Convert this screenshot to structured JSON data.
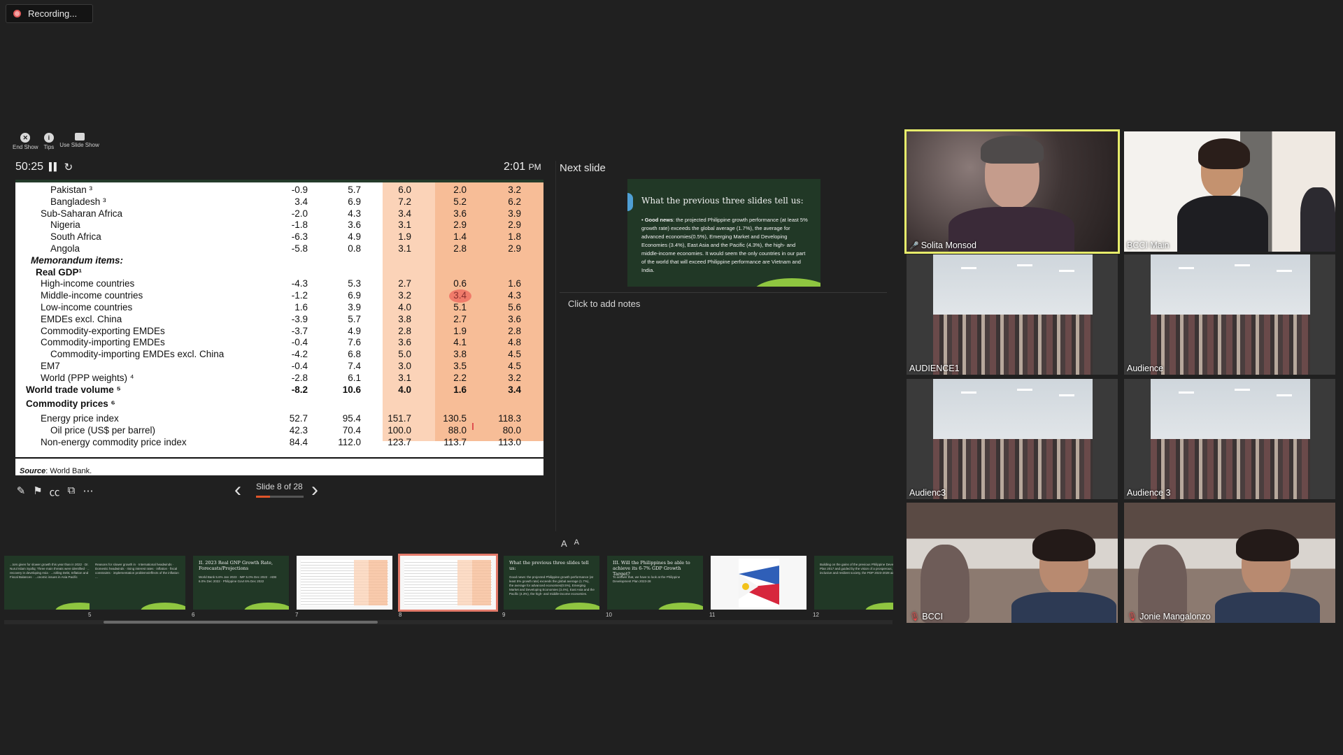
{
  "recording": {
    "label": "Recording..."
  },
  "toolbar": {
    "end_show": "End Show",
    "tips": "Tips",
    "use_slide_show": "Use Slide Show"
  },
  "presenter": {
    "elapsed": "50:25",
    "clock_time": "2:01",
    "clock_ampm": "PM",
    "slide_counter": "Slide 8 of 28",
    "progress_fraction": 0.29,
    "next_slide_label": "Next slide",
    "notes_placeholder": "Click to add notes",
    "font_larger": "A",
    "font_smaller": "A"
  },
  "current_slide": {
    "source_label": "Source",
    "source_text": ": World Bank.",
    "highlighted_value": "3.4",
    "rows": [
      {
        "label": "Pakistan ³",
        "indent": 3,
        "style": "normal",
        "values": [
          "-0.9",
          "5.7",
          "6.0",
          "2.0",
          "3.2"
        ]
      },
      {
        "label": "Bangladesh ³",
        "indent": 3,
        "style": "normal",
        "values": [
          "3.4",
          "6.9",
          "7.2",
          "5.2",
          "6.2"
        ]
      },
      {
        "label": "Sub-Saharan Africa",
        "indent": 2,
        "style": "normal",
        "values": [
          "-2.0",
          "4.3",
          "3.4",
          "3.6",
          "3.9"
        ]
      },
      {
        "label": "Nigeria",
        "indent": 3,
        "style": "normal",
        "values": [
          "-1.8",
          "3.6",
          "3.1",
          "2.9",
          "2.9"
        ]
      },
      {
        "label": "South Africa",
        "indent": 3,
        "style": "normal",
        "values": [
          "-6.3",
          "4.9",
          "1.9",
          "1.4",
          "1.8"
        ]
      },
      {
        "label": "Angola",
        "indent": 3,
        "style": "normal",
        "values": [
          "-5.8",
          "0.8",
          "3.1",
          "2.8",
          "2.9"
        ]
      },
      {
        "label": "Memorandum items:",
        "indent": 1,
        "style": "italic",
        "values": [
          "",
          "",
          "",
          "",
          ""
        ]
      },
      {
        "label": "Real GDP¹",
        "indent": 1.5,
        "style": "bold",
        "values": [
          "",
          "",
          "",
          "",
          ""
        ]
      },
      {
        "label": "High-income countries",
        "indent": 2,
        "style": "normal",
        "values": [
          "-4.3",
          "5.3",
          "2.7",
          "0.6",
          "1.6"
        ]
      },
      {
        "label": "Middle-income countries",
        "indent": 2,
        "style": "normal",
        "values": [
          "-1.2",
          "6.9",
          "3.2",
          "3.4",
          "4.3"
        ]
      },
      {
        "label": "Low-income countries",
        "indent": 2,
        "style": "normal",
        "values": [
          "1.6",
          "3.9",
          "4.0",
          "5.1",
          "5.6"
        ]
      },
      {
        "label": "EMDEs excl. China",
        "indent": 2,
        "style": "normal",
        "values": [
          "-3.9",
          "5.7",
          "3.8",
          "2.7",
          "3.6"
        ]
      },
      {
        "label": "Commodity-exporting EMDEs",
        "indent": 2,
        "style": "normal",
        "values": [
          "-3.7",
          "4.9",
          "2.8",
          "1.9",
          "2.8"
        ]
      },
      {
        "label": "Commodity-importing EMDEs",
        "indent": 2,
        "style": "normal",
        "values": [
          "-0.4",
          "7.6",
          "3.6",
          "4.1",
          "4.8"
        ]
      },
      {
        "label": "Commodity-importing EMDEs excl. China",
        "indent": 3,
        "style": "normal",
        "values": [
          "-4.2",
          "6.8",
          "5.0",
          "3.8",
          "4.5"
        ]
      },
      {
        "label": "EM7",
        "indent": 2,
        "style": "normal",
        "values": [
          "-0.4",
          "7.4",
          "3.0",
          "3.5",
          "4.5"
        ]
      },
      {
        "label": "World (PPP weights) ⁴",
        "indent": 2,
        "style": "normal",
        "values": [
          "-2.8",
          "6.1",
          "3.1",
          "2.2",
          "3.2"
        ]
      },
      {
        "label": "World trade volume ⁵",
        "indent": 0.5,
        "style": "bold",
        "values": [
          "-8.2",
          "10.6",
          "4.0",
          "1.6",
          "3.4"
        ]
      },
      {
        "label": "Commodity prices ⁶",
        "indent": 0.5,
        "style": "bold",
        "values": [
          "",
          "",
          "",
          "",
          ""
        ],
        "gap_before": 4
      },
      {
        "label": "Energy price index",
        "indent": 2,
        "style": "normal",
        "values": [
          "52.7",
          "95.4",
          "151.7",
          "130.5",
          "118.3"
        ],
        "gap_before": 4
      },
      {
        "label": "Oil price (US$ per barrel)",
        "indent": 3,
        "style": "normal",
        "values": [
          "42.3",
          "70.4",
          "100.0",
          "88.0",
          "80.0"
        ]
      },
      {
        "label": "Non-energy commodity price index",
        "indent": 2,
        "style": "normal",
        "values": [
          "84.4",
          "112.0",
          "123.7",
          "113.7",
          "113.0"
        ]
      }
    ]
  },
  "next_slide": {
    "title": "What the previous three slides tell us:",
    "bold_lead": "Good news",
    "body": ": the projected Philippine growth performance (at least 5% growth rate) exceeds the global average (1.7%), the average for advanced economies(0.5%), Emerging Market and Developing Economies (3.4%), East Asia and the Pacific (4.3%), the high- and middle-income economies. It would seem the only countries in our part of the world that will exceed Philippine performance are Vietnam and India."
  },
  "thumbnails": [
    {
      "num": "",
      "type": "text",
      "title": "",
      "body": "...tors given for slower growth this year than in 2022 · Dr. Nurul Islam Syafiq: Three main threats were identified · ...s recovery in developing Asia · ...rolling Debt, Inflation and Fiscal Balances · ...onomic issues in Asia Pacific"
    },
    {
      "num": "5",
      "type": "text",
      "title": "",
      "body": "Reasons for slower growth in · International headwinds · Domestic headwinds · rising interest rates · inflation · fiscal constraints · implementation problems/effects of the inflation ..."
    },
    {
      "num": "6",
      "type": "text",
      "title": "II. 2023 Real GNP Growth Rate, Forecasts/Projections",
      "body": "World Bank 5.6% Jan 2023 · IMF 5.0% Dec 2022 · ADB 6.0% Dec 2022 · Philippine Govt 6% Dec 2022"
    },
    {
      "num": "7",
      "type": "table",
      "title": "",
      "body": ""
    },
    {
      "num": "8",
      "type": "table",
      "title": "",
      "body": "",
      "current": true
    },
    {
      "num": "9",
      "type": "text",
      "title": "What the previous three slides tell us:",
      "body": "Good news: the projected Philippine growth performance (at least 5% growth rate) exceeds the global average (1.7%), the average for advanced economies(0.5%), Emerging Market and Developing Economies (3.4%), East Asia and the Pacific (4.3%), the high- and middle-income economies."
    },
    {
      "num": "10",
      "type": "text",
      "title": "III. Will the Philippines be able to achieve its 6-7% GDP Growth Target?",
      "body": "To answer that, we have to look at the Philippine Development Plan 2023-28"
    },
    {
      "num": "11",
      "type": "flag",
      "title": "",
      "body": ""
    },
    {
      "num": "12",
      "type": "text",
      "title": "",
      "body": "Building on the gains of the previous Philippine Development Plan 2017 and guided by the vision of a prosperous, inclusive and resilient society, the PDP 2023-2028 aims to ..."
    }
  ],
  "participants": [
    {
      "name": "Solita Monsod",
      "muted": false,
      "active": true
    },
    {
      "name": "BCCI Main",
      "muted": false,
      "active": false
    },
    {
      "name": "AUDIENCE1",
      "muted": false,
      "active": false
    },
    {
      "name": "Audience",
      "muted": false,
      "active": false
    },
    {
      "name": "Audienc3",
      "muted": false,
      "active": false
    },
    {
      "name": "Audience 3",
      "muted": false,
      "active": false
    },
    {
      "name": "BCCI",
      "muted": true,
      "active": false
    },
    {
      "name": "Jonie Mangalonzo",
      "muted": true,
      "active": false
    }
  ],
  "colors": {
    "accent_active": "#e7ec6b",
    "slide_green": "#213826",
    "table_peach": "#fbd3b8",
    "progress": "#e0552a",
    "mute_red": "#e84a4a"
  }
}
